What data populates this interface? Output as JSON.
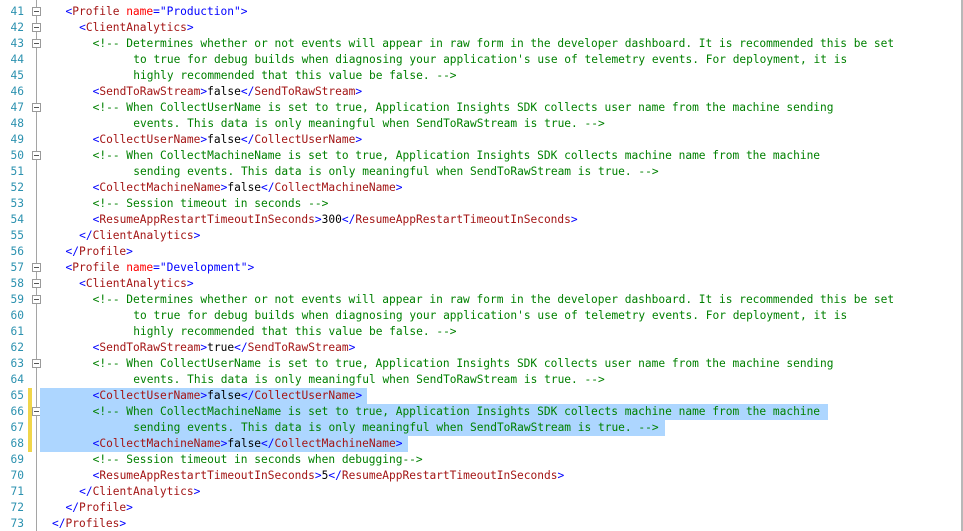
{
  "editor": {
    "lines": [
      {
        "n": "41",
        "indent": 2,
        "fold": true,
        "segs": [
          [
            "d",
            "<"
          ],
          [
            "t",
            "Profile"
          ],
          [
            "x",
            " "
          ],
          [
            "a",
            "name"
          ],
          [
            "d",
            "="
          ],
          [
            "v",
            "\"Production\""
          ],
          [
            "d",
            ">"
          ]
        ]
      },
      {
        "n": "42",
        "indent": 3,
        "fold": true,
        "segs": [
          [
            "d",
            "<"
          ],
          [
            "t",
            "ClientAnalytics"
          ],
          [
            "d",
            ">"
          ]
        ]
      },
      {
        "n": "43",
        "indent": 4,
        "fold": true,
        "segs": [
          [
            "c",
            "<!-- Determines whether or not events will appear in raw form in the developer dashboard. It is recommended this be set"
          ]
        ]
      },
      {
        "n": "44",
        "indent": 7,
        "segs": [
          [
            "c",
            "to true for debug builds when diagnosing your application's use of telemetry events. For deployment, it is"
          ]
        ]
      },
      {
        "n": "45",
        "indent": 7,
        "segs": [
          [
            "c",
            "highly recommended that this value be false. -->"
          ]
        ]
      },
      {
        "n": "46",
        "indent": 4,
        "segs": [
          [
            "d",
            "<"
          ],
          [
            "t",
            "SendToRawStream"
          ],
          [
            "d",
            ">"
          ],
          [
            "x",
            "false"
          ],
          [
            "d",
            "</"
          ],
          [
            "t",
            "SendToRawStream"
          ],
          [
            "d",
            ">"
          ]
        ]
      },
      {
        "n": "47",
        "indent": 4,
        "fold": true,
        "segs": [
          [
            "c",
            "<!-- When CollectUserName is set to true, Application Insights SDK collects user name from the machine sending"
          ]
        ]
      },
      {
        "n": "48",
        "indent": 7,
        "segs": [
          [
            "c",
            "events. This data is only meaningful when SendToRawStream is true. -->"
          ]
        ]
      },
      {
        "n": "49",
        "indent": 4,
        "segs": [
          [
            "d",
            "<"
          ],
          [
            "t",
            "CollectUserName"
          ],
          [
            "d",
            ">"
          ],
          [
            "x",
            "false"
          ],
          [
            "d",
            "</"
          ],
          [
            "t",
            "CollectUserName"
          ],
          [
            "d",
            ">"
          ]
        ]
      },
      {
        "n": "50",
        "indent": 4,
        "fold": true,
        "segs": [
          [
            "c",
            "<!-- When CollectMachineName is set to true, Application Insights SDK collects machine name from the machine"
          ]
        ]
      },
      {
        "n": "51",
        "indent": 7,
        "segs": [
          [
            "c",
            "sending events. This data is only meaningful when SendToRawStream is true. -->"
          ]
        ]
      },
      {
        "n": "52",
        "indent": 4,
        "segs": [
          [
            "d",
            "<"
          ],
          [
            "t",
            "CollectMachineName"
          ],
          [
            "d",
            ">"
          ],
          [
            "x",
            "false"
          ],
          [
            "d",
            "</"
          ],
          [
            "t",
            "CollectMachineName"
          ],
          [
            "d",
            ">"
          ]
        ]
      },
      {
        "n": "53",
        "indent": 4,
        "segs": [
          [
            "c",
            "<!-- Session timeout in seconds -->"
          ]
        ]
      },
      {
        "n": "54",
        "indent": 4,
        "segs": [
          [
            "d",
            "<"
          ],
          [
            "t",
            "ResumeAppRestartTimeoutInSeconds"
          ],
          [
            "d",
            ">"
          ],
          [
            "x",
            "300"
          ],
          [
            "d",
            "</"
          ],
          [
            "t",
            "ResumeAppRestartTimeoutInSeconds"
          ],
          [
            "d",
            ">"
          ]
        ]
      },
      {
        "n": "55",
        "indent": 3,
        "segs": [
          [
            "d",
            "</"
          ],
          [
            "t",
            "ClientAnalytics"
          ],
          [
            "d",
            ">"
          ]
        ]
      },
      {
        "n": "56",
        "indent": 2,
        "segs": [
          [
            "d",
            "</"
          ],
          [
            "t",
            "Profile"
          ],
          [
            "d",
            ">"
          ]
        ]
      },
      {
        "n": "57",
        "indent": 2,
        "fold": true,
        "segs": [
          [
            "d",
            "<"
          ],
          [
            "t",
            "Profile"
          ],
          [
            "x",
            " "
          ],
          [
            "a",
            "name"
          ],
          [
            "d",
            "="
          ],
          [
            "v",
            "\"Development\""
          ],
          [
            "d",
            ">"
          ]
        ]
      },
      {
        "n": "58",
        "indent": 3,
        "fold": true,
        "segs": [
          [
            "d",
            "<"
          ],
          [
            "t",
            "ClientAnalytics"
          ],
          [
            "d",
            ">"
          ]
        ]
      },
      {
        "n": "59",
        "indent": 4,
        "fold": true,
        "segs": [
          [
            "c",
            "<!-- Determines whether or not events will appear in raw form in the developer dashboard. It is recommended this be set"
          ]
        ]
      },
      {
        "n": "60",
        "indent": 7,
        "segs": [
          [
            "c",
            "to true for debug builds when diagnosing your application's use of telemetry events. For deployment, it is"
          ]
        ]
      },
      {
        "n": "61",
        "indent": 7,
        "segs": [
          [
            "c",
            "highly recommended that this value be false. -->"
          ]
        ]
      },
      {
        "n": "62",
        "indent": 4,
        "segs": [
          [
            "d",
            "<"
          ],
          [
            "t",
            "SendToRawStream"
          ],
          [
            "d",
            ">"
          ],
          [
            "x",
            "true"
          ],
          [
            "d",
            "</"
          ],
          [
            "t",
            "SendToRawStream"
          ],
          [
            "d",
            ">"
          ]
        ]
      },
      {
        "n": "63",
        "indent": 4,
        "fold": true,
        "segs": [
          [
            "c",
            "<!-- When CollectUserName is set to true, Application Insights SDK collects user name from the machine sending"
          ]
        ]
      },
      {
        "n": "64",
        "indent": 7,
        "segs": [
          [
            "c",
            "events. This data is only meaningful when SendToRawStream is true. -->"
          ]
        ]
      },
      {
        "n": "65",
        "indent": 4,
        "changed": true,
        "selected": true,
        "segs": [
          [
            "d",
            "<"
          ],
          [
            "t",
            "CollectUserName"
          ],
          [
            "d",
            ">"
          ],
          [
            "x",
            "false"
          ],
          [
            "d",
            "</"
          ],
          [
            "t",
            "CollectUserName"
          ],
          [
            "d",
            ">"
          ]
        ]
      },
      {
        "n": "66",
        "indent": 4,
        "fold": true,
        "changed": true,
        "selected": true,
        "segs": [
          [
            "c",
            "<!-- When CollectMachineName is set to true, Application Insights SDK collects machine name from the machine"
          ]
        ]
      },
      {
        "n": "67",
        "indent": 7,
        "changed": true,
        "selected": true,
        "segs": [
          [
            "c",
            "sending events. This data is only meaningful when SendToRawStream is true. -->"
          ]
        ]
      },
      {
        "n": "68",
        "indent": 4,
        "changed": true,
        "selected": true,
        "segs": [
          [
            "d",
            "<"
          ],
          [
            "t",
            "CollectMachineName"
          ],
          [
            "d",
            ">"
          ],
          [
            "x",
            "false"
          ],
          [
            "d",
            "</"
          ],
          [
            "t",
            "CollectMachineName"
          ],
          [
            "d",
            ">"
          ]
        ]
      },
      {
        "n": "69",
        "indent": 4,
        "segs": [
          [
            "c",
            "<!-- Session timeout in seconds when debugging-->"
          ]
        ]
      },
      {
        "n": "70",
        "indent": 4,
        "segs": [
          [
            "d",
            "<"
          ],
          [
            "t",
            "ResumeAppRestartTimeoutInSeconds"
          ],
          [
            "d",
            ">"
          ],
          [
            "x",
            "5"
          ],
          [
            "d",
            "</"
          ],
          [
            "t",
            "ResumeAppRestartTimeoutInSeconds"
          ],
          [
            "d",
            ">"
          ]
        ]
      },
      {
        "n": "71",
        "indent": 3,
        "segs": [
          [
            "d",
            "</"
          ],
          [
            "t",
            "ClientAnalytics"
          ],
          [
            "d",
            ">"
          ]
        ]
      },
      {
        "n": "72",
        "indent": 2,
        "segs": [
          [
            "d",
            "</"
          ],
          [
            "t",
            "Profile"
          ],
          [
            "d",
            ">"
          ]
        ]
      },
      {
        "n": "73",
        "indent": 1,
        "segs": [
          [
            "d",
            "</"
          ],
          [
            "t",
            "Profiles"
          ],
          [
            "d",
            ">"
          ]
        ]
      }
    ],
    "colors": {
      "line_number": "#2b91af",
      "tag": "#a31515",
      "delimiter": "#0000ff",
      "attribute": "#ff0000",
      "comment": "#008000",
      "selection": "#add6ff",
      "change_marker": "#f0d54a"
    }
  }
}
